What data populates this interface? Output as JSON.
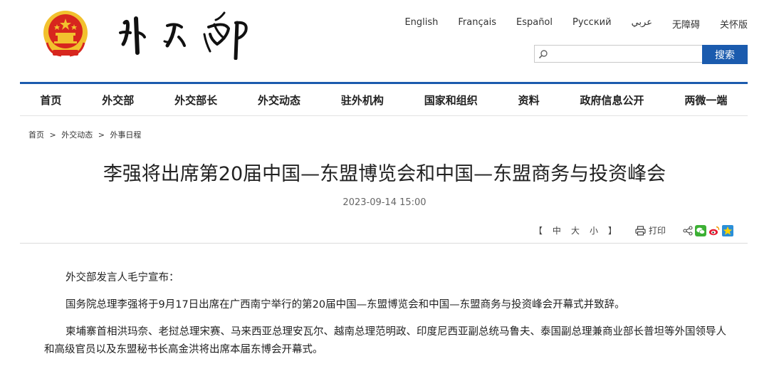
{
  "header": {
    "languages": [
      "English",
      "Français",
      "Español",
      "Русский",
      "عربي",
      "无障碍",
      "关怀版"
    ],
    "search": {
      "placeholder": "",
      "button_label": "搜索"
    }
  },
  "nav": {
    "items": [
      "首页",
      "外交部",
      "外交部长",
      "外交动态",
      "驻外机构",
      "国家和组织",
      "资料",
      "政府信息公开",
      "两微一端"
    ]
  },
  "breadcrumb": {
    "items": [
      "首页",
      "外交动态",
      "外事日程"
    ],
    "separator": ">"
  },
  "article": {
    "title": "李强将出席第20届中国—东盟博览会和中国—东盟商务与投资峰会",
    "date": "2023-09-14 15:00",
    "paragraphs": [
      "外交部发言人毛宁宣布：",
      "国务院总理李强将于9月17日出席在广西南宁举行的第20届中国—东盟博览会和中国—东盟商务与投资峰会开幕式并致辞。",
      "柬埔寨首相洪玛奈、老挝总理宋赛、马来西亚总理安瓦尔、越南总理范明政、印度尼西亚副总统马鲁夫、泰国副总理兼商业部长普坦等外国领导人和高级官员以及东盟秘书长高金洪将出席本届东博会开幕式。"
    ]
  },
  "tools": {
    "bracket_open": "【",
    "font_sizes": [
      "中",
      "大",
      "小"
    ],
    "bracket_close": "】",
    "print_label": "打印"
  },
  "colors": {
    "accent": "#1b5bae",
    "emblem_red": "#d7261e",
    "emblem_gold": "#f2c12e"
  }
}
